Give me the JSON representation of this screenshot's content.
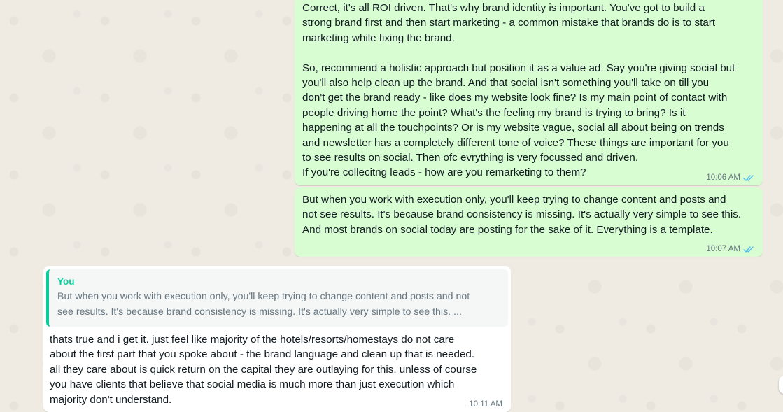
{
  "messages": [
    {
      "direction": "outgoing",
      "text": "Correct, it's all ROI driven. That's why brand identity is important. You've got to build a\nstrong brand first and then start marketing - a common mistake that brands do is to start\nmarketing while fixing the brand.\n\nSo, recommend a holistic approach but position it as a value ad. Say you're giving social but\nyou'll also help clean up the brand. And that social isn't something you'll take on till you\ndon't get the brand ready - like does my website look fine? Is my main point of contact with\npeople driving home the point? What's the feeling my brand is trying to bring? Is it\nhappening at all the touchpoints? Or is my website vague, social all about being on trends\nand newsletter has a completely different tone of voice? These things are important for you\nto see results on social. Then ofc evrything is very focussed and driven.\nIf you're collecitng leads - how are you remarketing to them?",
      "time": "10:06 AM",
      "status": "read",
      "status_icon": "double-check-icon"
    },
    {
      "direction": "outgoing",
      "text": "But when you work with execution only, you'll keep trying to change content and posts and\nnot see results. It's because brand consistency is missing. It's actually very simple to see this.\nAnd most brands on social today are posting for the sake of it. Everything is a template.",
      "time": "10:07 AM",
      "status": "read",
      "status_icon": "double-check-icon"
    },
    {
      "direction": "incoming",
      "quoted": {
        "author": "You",
        "text": "But when you work with execution only, you'll keep trying to change content and posts and not\nsee results. It's because brand consistency is missing. It's actually very simple to see this. ..."
      },
      "text": "thats true and i get it. just feel like majority of the hotels/resorts/homestays do not care\nabout the first part that you spoke about - the brand language and clean up that is needed.\nall they care about is quick return on the capital they are outlaying for this. unless of course\nyou have clients that believe that social media is much more than just execution which\nmajority don't understand.",
      "time": "10:11 AM"
    }
  ],
  "colors": {
    "chat_background": "#efeae2",
    "outgoing_bubble": "#d9fdd3",
    "incoming_bubble": "#ffffff",
    "quote_accent": "#06cf9c",
    "read_ticks": "#53bdeb",
    "meta_text": "#667781"
  }
}
